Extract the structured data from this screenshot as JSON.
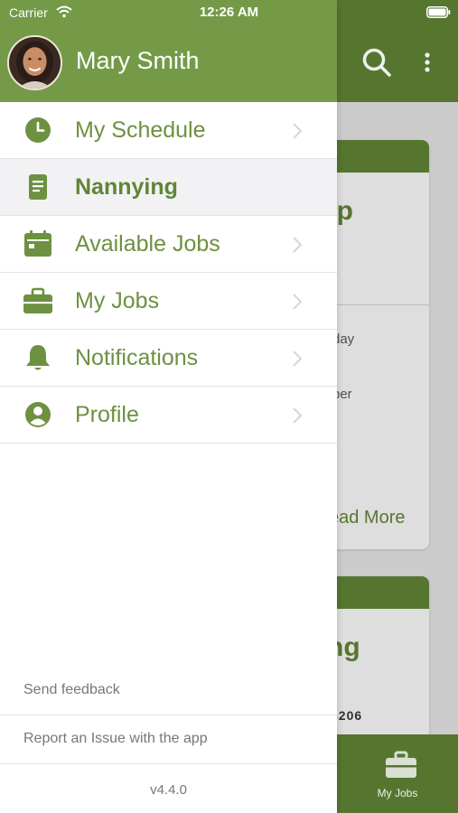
{
  "status_bar": {
    "carrier": "Carrier",
    "time": "12:26 AM"
  },
  "drawer": {
    "user_name": "Mary Smith",
    "menu_items": [
      {
        "label": "My Schedule",
        "icon": "clock-icon"
      },
      {
        "label": "Nannying",
        "icon": "document-icon",
        "selected": true
      },
      {
        "label": "Available Jobs",
        "icon": "calendar-icon"
      },
      {
        "label": "My Jobs",
        "icon": "briefcase-icon"
      },
      {
        "label": "Notifications",
        "icon": "bell-icon"
      },
      {
        "label": "Profile",
        "icon": "person-icon"
      }
    ],
    "footer": {
      "send_feedback": "Send feedback",
      "report_issue": "Report an Issue with the app",
      "version": "v4.4.0"
    }
  },
  "background": {
    "card1_title_fragment": "ep",
    "card1_line1_fragment": "day",
    "card1_line2_fragment": "ber",
    "card1_link_fragment": "ead More",
    "card2_title_fragment": "ng",
    "card2_line_fragment": "3206",
    "tab_label": "My Jobs"
  },
  "colors": {
    "header_green": "#749a47",
    "accent_green": "#6d9140",
    "dark_green": "#5c7e34"
  }
}
